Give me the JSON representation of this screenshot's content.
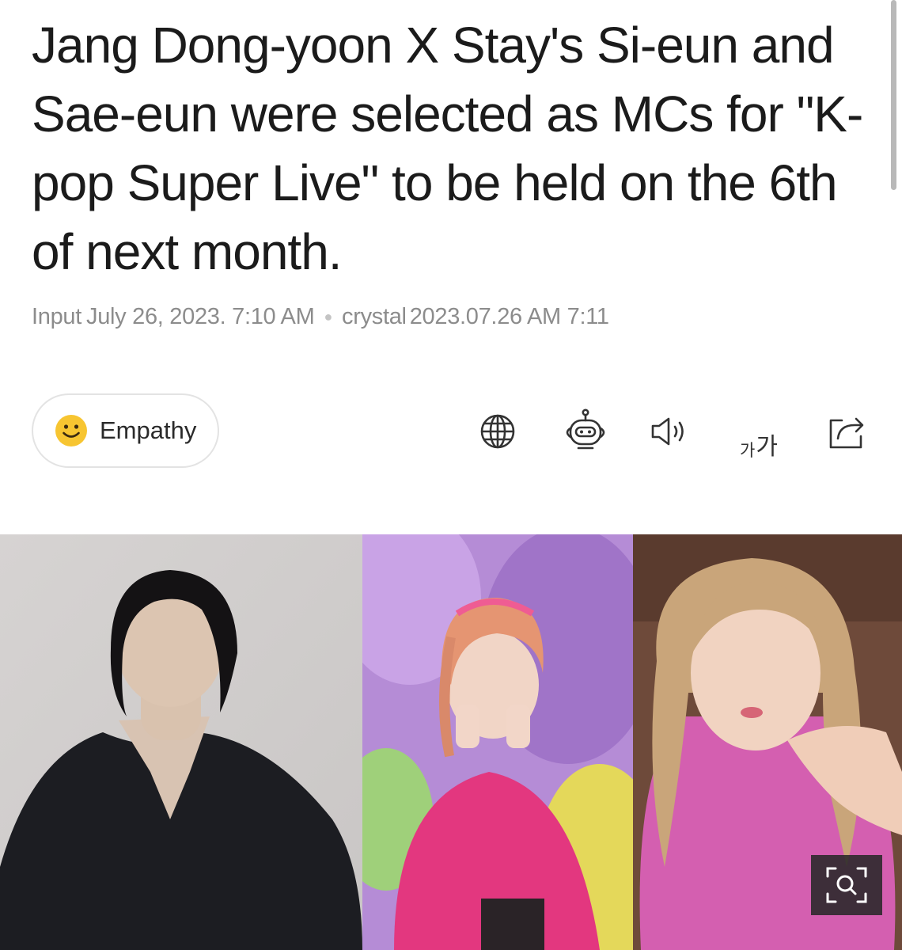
{
  "article": {
    "headline": "Jang Dong-yoon X Stay's Si-eun and Sae-eun were selected as MCs for \"K-pop Super Live\" to be held on the 6th of next month.",
    "input_label": "Input",
    "input_date": "July 26, 2023. 7:10 AM",
    "author": "crystal",
    "updated": "2023.07.26 AM 7:11"
  },
  "actions": {
    "empathy_label": "Empathy",
    "font_size_small": "가",
    "font_size_big": "가"
  },
  "icons": {
    "empathy": "smiley-icon",
    "translate": "globe-icon",
    "summary": "robot-icon",
    "listen": "speaker-icon",
    "font_size": "font-size-icon",
    "share": "share-icon",
    "zoom": "magnify-icon"
  },
  "colors": {
    "smiley": "#f7c531",
    "meta_text": "#8c8c8c",
    "zoom_bg": "#2a2a2a"
  }
}
